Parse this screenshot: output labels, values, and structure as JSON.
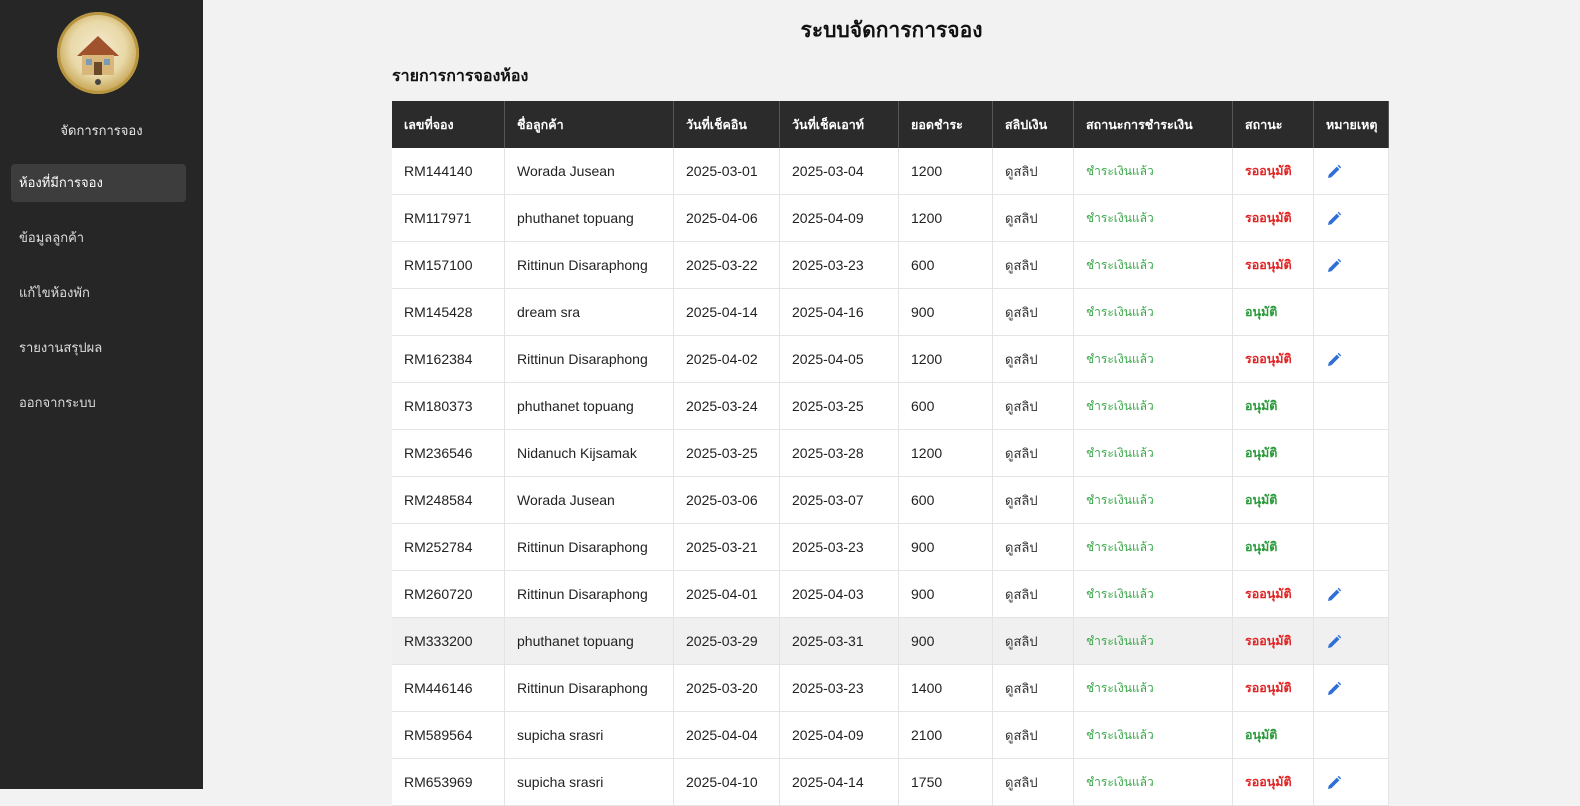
{
  "sidebar": {
    "logo_alt": "Pattaya Cat Home",
    "title": "จัดการการจอง",
    "items": [
      {
        "label": "ห้องที่มีการจอง",
        "active": true
      },
      {
        "label": "ข้อมูลลูกค้า",
        "active": false
      },
      {
        "label": "แก้ไขห้องพัก",
        "active": false
      },
      {
        "label": "รายงานสรุปผล",
        "active": false
      },
      {
        "label": "ออกจากระบบ",
        "active": false
      }
    ]
  },
  "header": {
    "title": "ระบบจัดการการจอง"
  },
  "main": {
    "section_title": "รายการการจองห้อง",
    "columns": [
      "เลขที่จอง",
      "ชื่อลูกค้า",
      "วันที่เช็คอิน",
      "วันที่เช็คเอาท์",
      "ยอดชำระ",
      "สลิปเงิน",
      "สถานะการชำระเงิน",
      "สถานะ",
      "หมายเหตุ"
    ],
    "rows": [
      {
        "id": "RM144140",
        "name": "Worada Jusean",
        "checkin": "2025-03-01",
        "checkout": "2025-03-04",
        "amount": "1200",
        "slip": "ดูสลิป",
        "payment": "ชำระเงินแล้ว",
        "status": "รออนุมัติ",
        "editable": true
      },
      {
        "id": "RM117971",
        "name": "phuthanet topuang",
        "checkin": "2025-04-06",
        "checkout": "2025-04-09",
        "amount": "1200",
        "slip": "ดูสลิป",
        "payment": "ชำระเงินแล้ว",
        "status": "รออนุมัติ",
        "editable": true
      },
      {
        "id": "RM157100",
        "name": "Rittinun Disaraphong",
        "checkin": "2025-03-22",
        "checkout": "2025-03-23",
        "amount": "600",
        "slip": "ดูสลิป",
        "payment": "ชำระเงินแล้ว",
        "status": "รออนุมัติ",
        "editable": true
      },
      {
        "id": "RM145428",
        "name": "dream sra",
        "checkin": "2025-04-14",
        "checkout": "2025-04-16",
        "amount": "900",
        "slip": "ดูสลิป",
        "payment": "ชำระเงินแล้ว",
        "status": "อนุมัติ",
        "editable": false
      },
      {
        "id": "RM162384",
        "name": "Rittinun Disaraphong",
        "checkin": "2025-04-02",
        "checkout": "2025-04-05",
        "amount": "1200",
        "slip": "ดูสลิป",
        "payment": "ชำระเงินแล้ว",
        "status": "รออนุมัติ",
        "editable": true
      },
      {
        "id": "RM180373",
        "name": "phuthanet topuang",
        "checkin": "2025-03-24",
        "checkout": "2025-03-25",
        "amount": "600",
        "slip": "ดูสลิป",
        "payment": "ชำระเงินแล้ว",
        "status": "อนุมัติ",
        "editable": false
      },
      {
        "id": "RM236546",
        "name": "Nidanuch Kijsamak",
        "checkin": "2025-03-25",
        "checkout": "2025-03-28",
        "amount": "1200",
        "slip": "ดูสลิป",
        "payment": "ชำระเงินแล้ว",
        "status": "อนุมัติ",
        "editable": false
      },
      {
        "id": "RM248584",
        "name": "Worada Jusean",
        "checkin": "2025-03-06",
        "checkout": "2025-03-07",
        "amount": "600",
        "slip": "ดูสลิป",
        "payment": "ชำระเงินแล้ว",
        "status": "อนุมัติ",
        "editable": false
      },
      {
        "id": "RM252784",
        "name": "Rittinun Disaraphong",
        "checkin": "2025-03-21",
        "checkout": "2025-03-23",
        "amount": "900",
        "slip": "ดูสลิป",
        "payment": "ชำระเงินแล้ว",
        "status": "อนุมัติ",
        "editable": false
      },
      {
        "id": "RM260720",
        "name": "Rittinun Disaraphong",
        "checkin": "2025-04-01",
        "checkout": "2025-04-03",
        "amount": "900",
        "slip": "ดูสลิป",
        "payment": "ชำระเงินแล้ว",
        "status": "รออนุมัติ",
        "editable": true
      },
      {
        "id": "RM333200",
        "name": "phuthanet topuang",
        "checkin": "2025-03-29",
        "checkout": "2025-03-31",
        "amount": "900",
        "slip": "ดูสลิป",
        "payment": "ชำระเงินแล้ว",
        "status": "รออนุมัติ",
        "editable": true,
        "highlight": true
      },
      {
        "id": "RM446146",
        "name": "Rittinun Disaraphong",
        "checkin": "2025-03-20",
        "checkout": "2025-03-23",
        "amount": "1400",
        "slip": "ดูสลิป",
        "payment": "ชำระเงินแล้ว",
        "status": "รออนุมัติ",
        "editable": true
      },
      {
        "id": "RM589564",
        "name": "supicha srasri",
        "checkin": "2025-04-04",
        "checkout": "2025-04-09",
        "amount": "2100",
        "slip": "ดูสลิป",
        "payment": "ชำระเงินแล้ว",
        "status": "อนุมัติ",
        "editable": false
      },
      {
        "id": "RM653969",
        "name": "supicha srasri",
        "checkin": "2025-04-10",
        "checkout": "2025-04-14",
        "amount": "1750",
        "slip": "ดูสลิป",
        "payment": "ชำระเงินแล้ว",
        "status": "รออนุมัติ",
        "editable": true
      }
    ],
    "colors": {
      "paid": "#3aa84a",
      "pending": "#e02424",
      "approved": "#2a9a3a",
      "edit_icon": "#2f6fd6"
    },
    "pending_value": "รออนุมัติ"
  }
}
